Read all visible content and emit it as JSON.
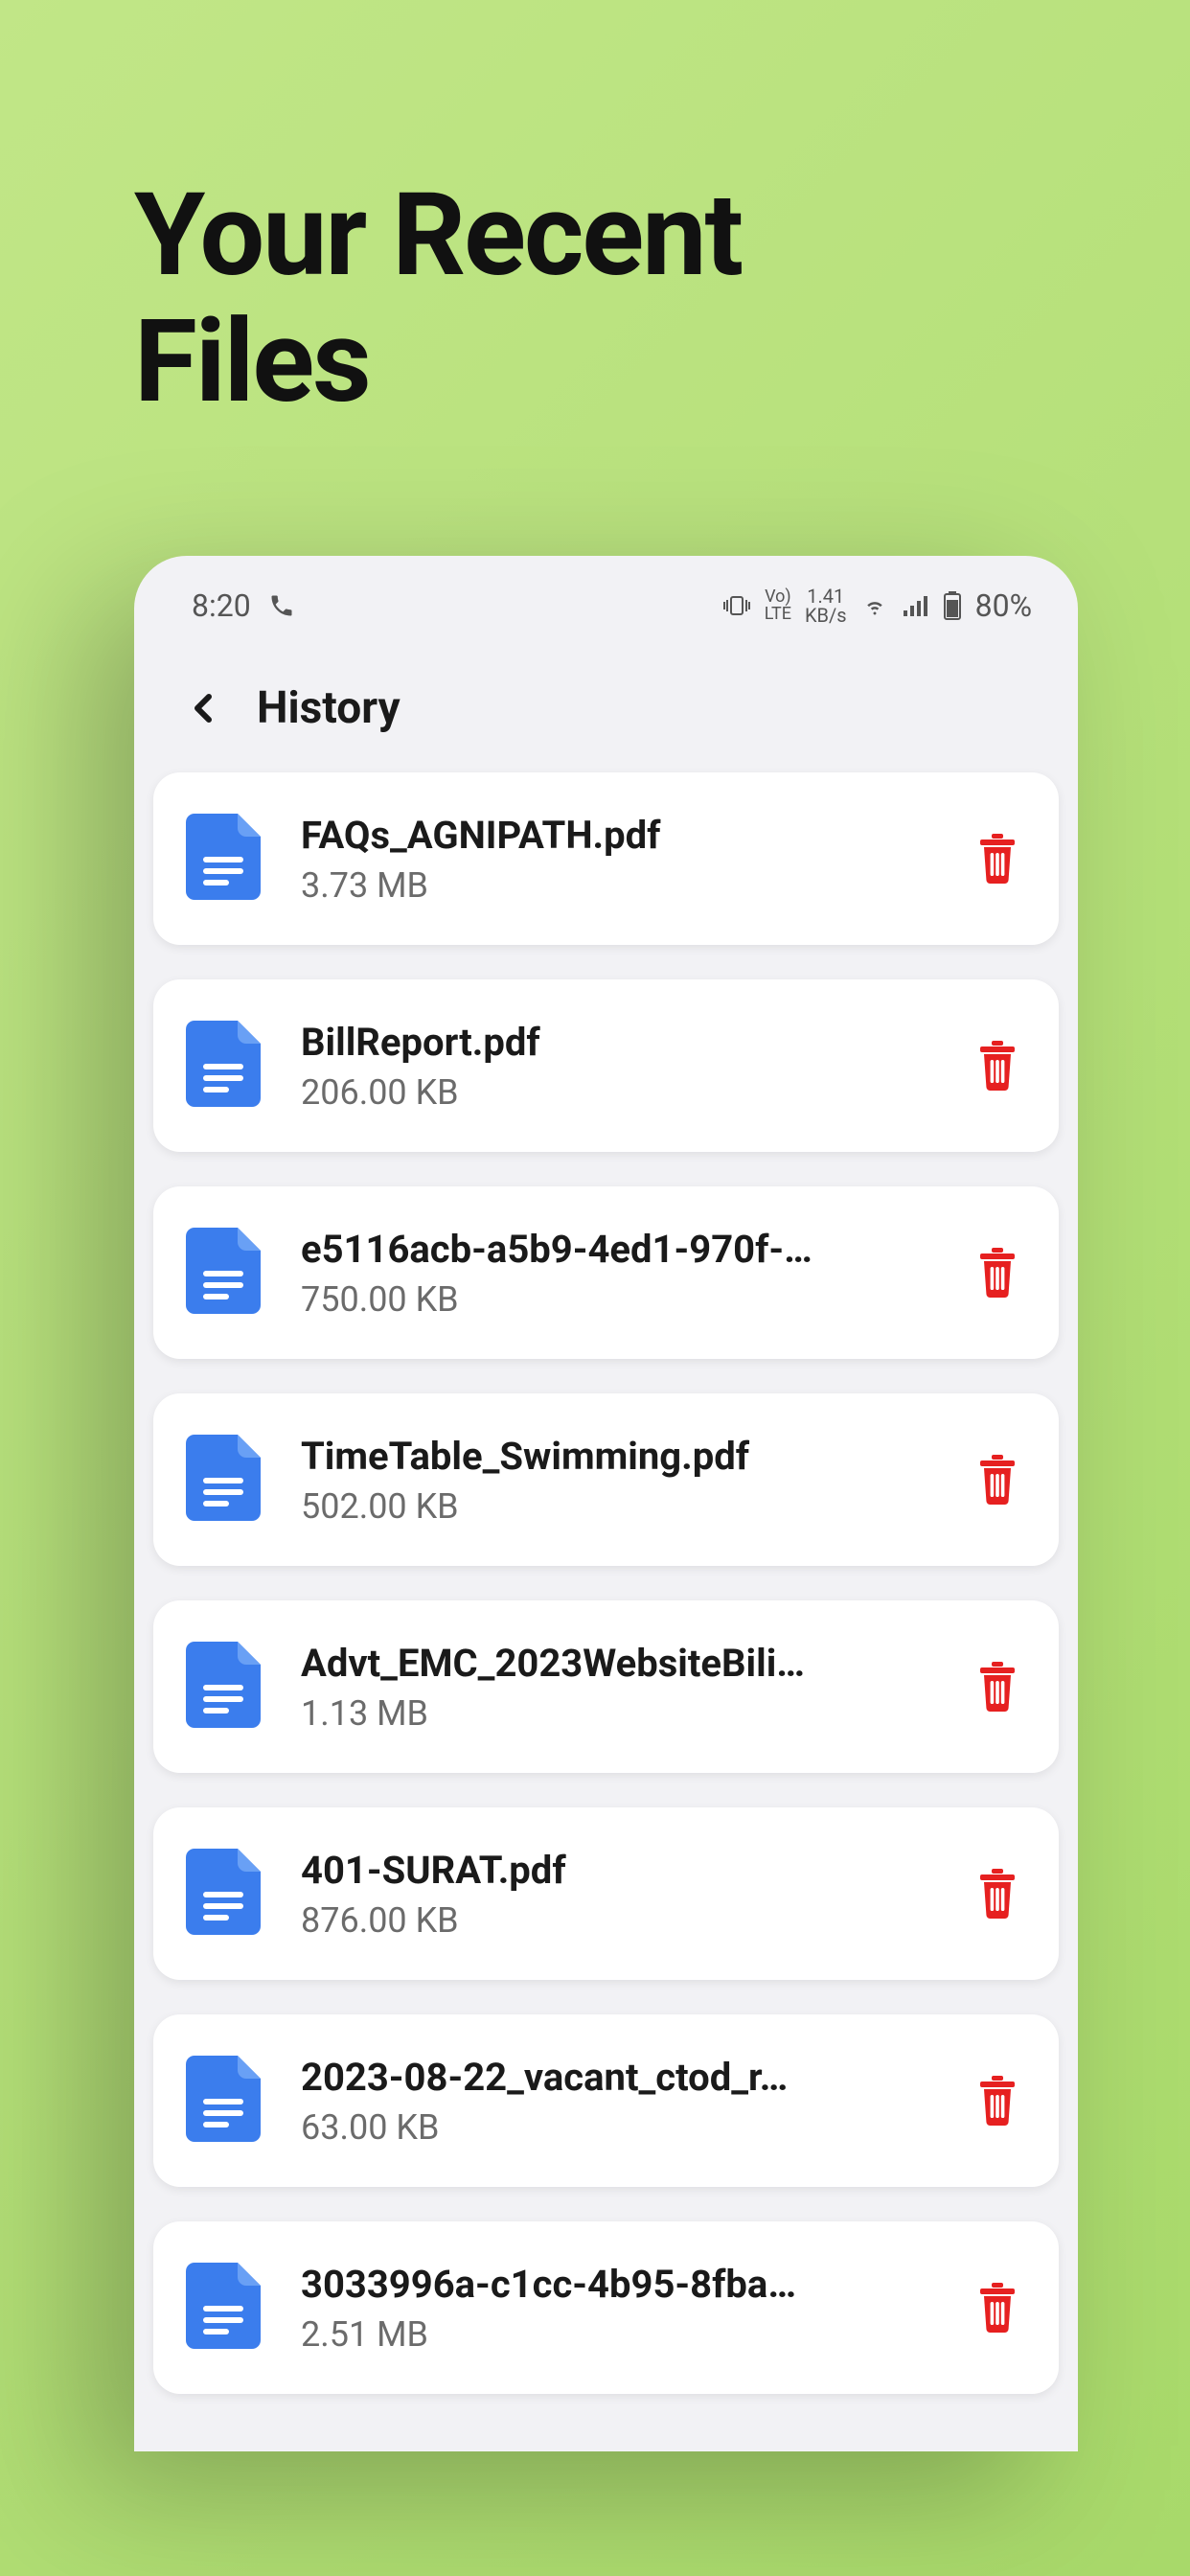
{
  "hero": {
    "line1": "Your Recent",
    "line2": "Files"
  },
  "status": {
    "time": "8:20",
    "speed_top": "1.41",
    "speed_bottom": "KB/s",
    "lte_top": "Vo)",
    "lte_bottom": "LTE",
    "battery": "80%"
  },
  "appbar": {
    "title": "History"
  },
  "files": [
    {
      "name": "FAQs_AGNIPATH.pdf",
      "size": "3.73 MB"
    },
    {
      "name": "BillReport.pdf",
      "size": "206.00 KB"
    },
    {
      "name": "e5116acb-a5b9-4ed1-970f-…",
      "size": "750.00 KB"
    },
    {
      "name": "TimeTable_Swimming.pdf",
      "size": "502.00 KB"
    },
    {
      "name": "Advt_EMC_2023WebsiteBili…",
      "size": "1.13 MB"
    },
    {
      "name": "401-SURAT.pdf",
      "size": "876.00 KB"
    },
    {
      "name": "2023-08-22_vacant_ctod_r…",
      "size": "63.00 KB"
    },
    {
      "name": "3033996a-c1cc-4b95-8fba…",
      "size": "2.51 MB"
    }
  ],
  "colors": {
    "fileIcon": "#3b7ded",
    "trash": "#e62020"
  }
}
